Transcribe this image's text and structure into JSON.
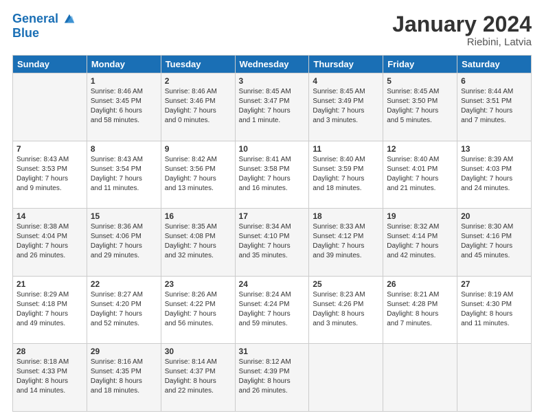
{
  "header": {
    "logo_line1": "General",
    "logo_line2": "Blue",
    "title": "January 2024",
    "subtitle": "Riebini, Latvia"
  },
  "columns": [
    "Sunday",
    "Monday",
    "Tuesday",
    "Wednesday",
    "Thursday",
    "Friday",
    "Saturday"
  ],
  "weeks": [
    [
      {
        "day": "",
        "info": ""
      },
      {
        "day": "1",
        "info": "Sunrise: 8:46 AM\nSunset: 3:45 PM\nDaylight: 6 hours\nand 58 minutes."
      },
      {
        "day": "2",
        "info": "Sunrise: 8:46 AM\nSunset: 3:46 PM\nDaylight: 7 hours\nand 0 minutes."
      },
      {
        "day": "3",
        "info": "Sunrise: 8:45 AM\nSunset: 3:47 PM\nDaylight: 7 hours\nand 1 minute."
      },
      {
        "day": "4",
        "info": "Sunrise: 8:45 AM\nSunset: 3:49 PM\nDaylight: 7 hours\nand 3 minutes."
      },
      {
        "day": "5",
        "info": "Sunrise: 8:45 AM\nSunset: 3:50 PM\nDaylight: 7 hours\nand 5 minutes."
      },
      {
        "day": "6",
        "info": "Sunrise: 8:44 AM\nSunset: 3:51 PM\nDaylight: 7 hours\nand 7 minutes."
      }
    ],
    [
      {
        "day": "7",
        "info": "Sunrise: 8:43 AM\nSunset: 3:53 PM\nDaylight: 7 hours\nand 9 minutes."
      },
      {
        "day": "8",
        "info": "Sunrise: 8:43 AM\nSunset: 3:54 PM\nDaylight: 7 hours\nand 11 minutes."
      },
      {
        "day": "9",
        "info": "Sunrise: 8:42 AM\nSunset: 3:56 PM\nDaylight: 7 hours\nand 13 minutes."
      },
      {
        "day": "10",
        "info": "Sunrise: 8:41 AM\nSunset: 3:58 PM\nDaylight: 7 hours\nand 16 minutes."
      },
      {
        "day": "11",
        "info": "Sunrise: 8:40 AM\nSunset: 3:59 PM\nDaylight: 7 hours\nand 18 minutes."
      },
      {
        "day": "12",
        "info": "Sunrise: 8:40 AM\nSunset: 4:01 PM\nDaylight: 7 hours\nand 21 minutes."
      },
      {
        "day": "13",
        "info": "Sunrise: 8:39 AM\nSunset: 4:03 PM\nDaylight: 7 hours\nand 24 minutes."
      }
    ],
    [
      {
        "day": "14",
        "info": "Sunrise: 8:38 AM\nSunset: 4:04 PM\nDaylight: 7 hours\nand 26 minutes."
      },
      {
        "day": "15",
        "info": "Sunrise: 8:36 AM\nSunset: 4:06 PM\nDaylight: 7 hours\nand 29 minutes."
      },
      {
        "day": "16",
        "info": "Sunrise: 8:35 AM\nSunset: 4:08 PM\nDaylight: 7 hours\nand 32 minutes."
      },
      {
        "day": "17",
        "info": "Sunrise: 8:34 AM\nSunset: 4:10 PM\nDaylight: 7 hours\nand 35 minutes."
      },
      {
        "day": "18",
        "info": "Sunrise: 8:33 AM\nSunset: 4:12 PM\nDaylight: 7 hours\nand 39 minutes."
      },
      {
        "day": "19",
        "info": "Sunrise: 8:32 AM\nSunset: 4:14 PM\nDaylight: 7 hours\nand 42 minutes."
      },
      {
        "day": "20",
        "info": "Sunrise: 8:30 AM\nSunset: 4:16 PM\nDaylight: 7 hours\nand 45 minutes."
      }
    ],
    [
      {
        "day": "21",
        "info": "Sunrise: 8:29 AM\nSunset: 4:18 PM\nDaylight: 7 hours\nand 49 minutes."
      },
      {
        "day": "22",
        "info": "Sunrise: 8:27 AM\nSunset: 4:20 PM\nDaylight: 7 hours\nand 52 minutes."
      },
      {
        "day": "23",
        "info": "Sunrise: 8:26 AM\nSunset: 4:22 PM\nDaylight: 7 hours\nand 56 minutes."
      },
      {
        "day": "24",
        "info": "Sunrise: 8:24 AM\nSunset: 4:24 PM\nDaylight: 7 hours\nand 59 minutes."
      },
      {
        "day": "25",
        "info": "Sunrise: 8:23 AM\nSunset: 4:26 PM\nDaylight: 8 hours\nand 3 minutes."
      },
      {
        "day": "26",
        "info": "Sunrise: 8:21 AM\nSunset: 4:28 PM\nDaylight: 8 hours\nand 7 minutes."
      },
      {
        "day": "27",
        "info": "Sunrise: 8:19 AM\nSunset: 4:30 PM\nDaylight: 8 hours\nand 11 minutes."
      }
    ],
    [
      {
        "day": "28",
        "info": "Sunrise: 8:18 AM\nSunset: 4:33 PM\nDaylight: 8 hours\nand 14 minutes."
      },
      {
        "day": "29",
        "info": "Sunrise: 8:16 AM\nSunset: 4:35 PM\nDaylight: 8 hours\nand 18 minutes."
      },
      {
        "day": "30",
        "info": "Sunrise: 8:14 AM\nSunset: 4:37 PM\nDaylight: 8 hours\nand 22 minutes."
      },
      {
        "day": "31",
        "info": "Sunrise: 8:12 AM\nSunset: 4:39 PM\nDaylight: 8 hours\nand 26 minutes."
      },
      {
        "day": "",
        "info": ""
      },
      {
        "day": "",
        "info": ""
      },
      {
        "day": "",
        "info": ""
      }
    ]
  ]
}
